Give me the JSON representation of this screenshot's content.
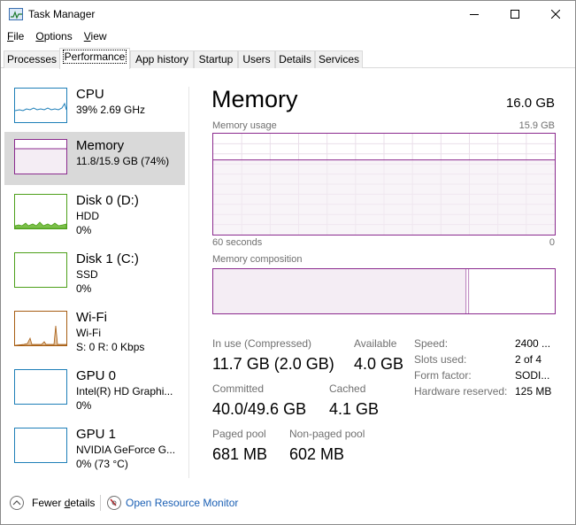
{
  "window": {
    "title": "Task Manager"
  },
  "menu": [
    {
      "label": "File",
      "key": "F",
      "rest": "ile"
    },
    {
      "label": "Options",
      "key": "O",
      "rest": "ptions"
    },
    {
      "label": "View",
      "key": "V",
      "rest": "iew"
    }
  ],
  "tabs": [
    "Processes",
    "Performance",
    "App history",
    "Startup",
    "Users",
    "Details",
    "Services"
  ],
  "active_tab": "Performance",
  "sidebar": {
    "items": [
      {
        "title": "CPU",
        "line1": "39%  2.69 GHz",
        "line2": "",
        "color": "#1e7fb8"
      },
      {
        "title": "Memory",
        "line1": "11.8/15.9 GB (74%)",
        "line2": "",
        "color": "#8b2a8e"
      },
      {
        "title": "Disk 0 (D:)",
        "line1": "HDD",
        "line2": "0%",
        "color": "#4da01a"
      },
      {
        "title": "Disk 1 (C:)",
        "line1": "SSD",
        "line2": "0%",
        "color": "#4da01a"
      },
      {
        "title": "Wi-Fi",
        "line1": "Wi-Fi",
        "line2": "S: 0 R: 0 Kbps",
        "color": "#a75d12"
      },
      {
        "title": "GPU 0",
        "line1": "Intel(R) HD Graphi...",
        "line2": "0%",
        "color": "#1e7fb8"
      },
      {
        "title": "GPU 1",
        "line1": "NVIDIA GeForce G...",
        "line2": "0%  (73 °C)",
        "color": "#1e7fb8"
      }
    ]
  },
  "main": {
    "title": "Memory",
    "total": "16.0 GB",
    "usage_label": "Memory usage",
    "usage_max": "15.9 GB",
    "time_left": "60 seconds",
    "time_right": "0",
    "usage_fraction": 0.74,
    "composition_label": "Memory composition",
    "composition_in_use_fraction": 0.74,
    "stats": {
      "in_use_label": "In use (Compressed)",
      "in_use_value": "11.7 GB (2.0 GB)",
      "available_label": "Available",
      "available_value": "4.0 GB",
      "committed_label": "Committed",
      "committed_value": "40.0/49.6 GB",
      "cached_label": "Cached",
      "cached_value": "4.1 GB",
      "paged_label": "Paged pool",
      "paged_value": "681 MB",
      "nonpaged_label": "Non-paged pool",
      "nonpaged_value": "602 MB"
    },
    "details": [
      {
        "label": "Speed:",
        "value": "2400 ..."
      },
      {
        "label": "Slots used:",
        "value": "2 of 4"
      },
      {
        "label": "Form factor:",
        "value": "SODI..."
      },
      {
        "label": "Hardware reserved:",
        "value": "125 MB"
      }
    ]
  },
  "footer": {
    "fewer_details": "Fewer details",
    "fewer_key": "d",
    "open_resource_monitor": "Open Resource Monitor"
  },
  "colors": {
    "memory": "#8b2a8e",
    "memory_fill": "#f4edf4",
    "link": "#1a5fb4"
  }
}
